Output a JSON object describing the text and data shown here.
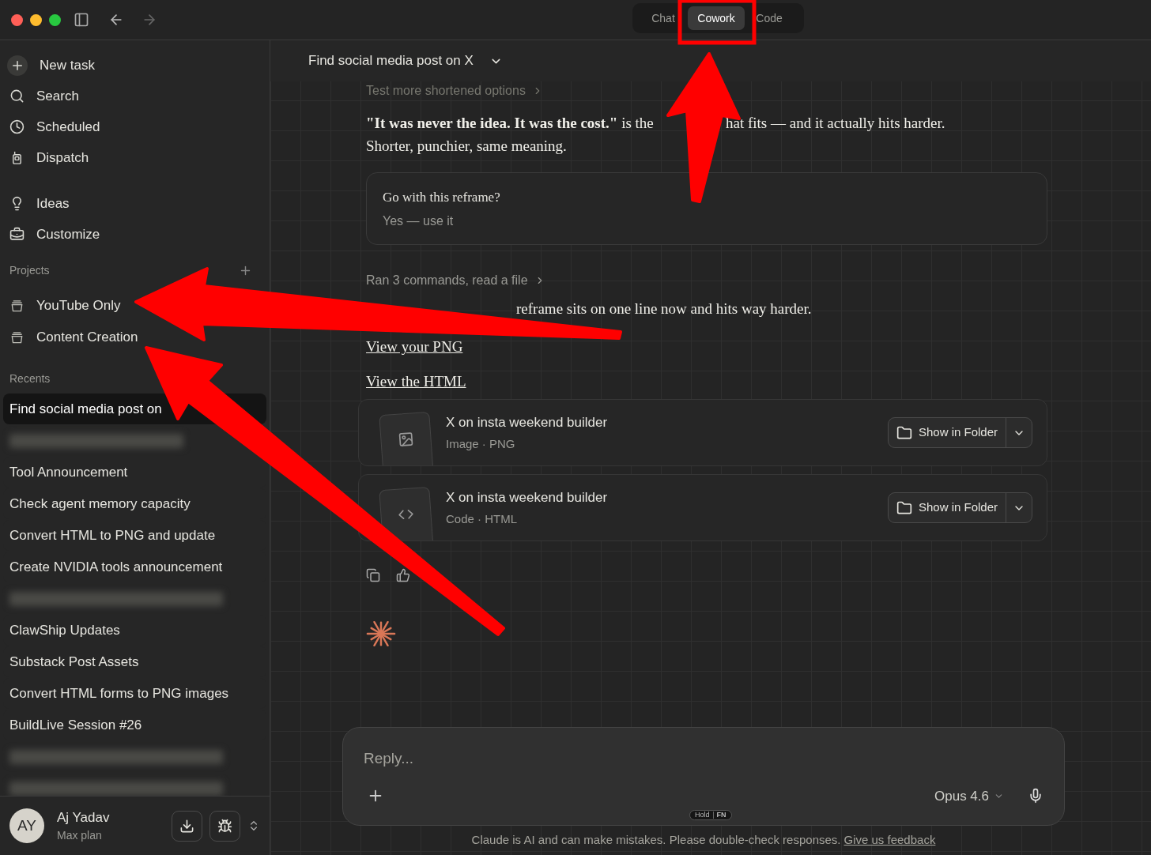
{
  "titlebar": {
    "tabs": [
      {
        "label": "Chat",
        "selected": false
      },
      {
        "label": "Cowork",
        "selected": true
      },
      {
        "label": "Code",
        "selected": false
      }
    ]
  },
  "sidebar": {
    "nav": [
      {
        "label": "New task",
        "kind": "new"
      },
      {
        "label": "Search",
        "kind": "search"
      },
      {
        "label": "Scheduled",
        "kind": "clock"
      },
      {
        "label": "Dispatch",
        "kind": "dispatch"
      }
    ],
    "nav_2": [
      {
        "label": "Ideas",
        "kind": "bulb"
      },
      {
        "label": "Customize",
        "kind": "toolbox"
      }
    ],
    "projects": {
      "title": "Projects",
      "items": [
        "YouTube Only",
        "Content Creation"
      ]
    },
    "recents": {
      "title": "Recents",
      "items": [
        {
          "kind": "chat",
          "label": "Find social media post on",
          "selected": true
        },
        {
          "kind": "blurred"
        },
        {
          "kind": "chat",
          "label": "Tool Announcement",
          "selected": false
        },
        {
          "kind": "chat",
          "label": "Check agent memory capacity",
          "selected": false
        },
        {
          "kind": "chat",
          "label": "Convert HTML to PNG and update",
          "selected": false
        },
        {
          "kind": "chat",
          "label": "Create NVIDIA tools announcement",
          "selected": false
        },
        {
          "kind": "blurred"
        },
        {
          "kind": "chat",
          "label": "ClawShip Updates",
          "selected": false
        },
        {
          "kind": "chat",
          "label": "Substack Post Assets",
          "selected": false
        },
        {
          "kind": "chat",
          "label": "Convert HTML forms to PNG images",
          "selected": false
        },
        {
          "kind": "chat",
          "label": "BuildLive Session #26",
          "selected": false
        },
        {
          "kind": "blurred"
        },
        {
          "kind": "blurred"
        }
      ]
    },
    "user": {
      "initials": "AY",
      "name": "Aj Yadav",
      "plan": "Max plan"
    }
  },
  "chat": {
    "title": "Find social media post on X",
    "steps_link_1": "Test more shortened options",
    "paragraph_1_part_a": "**\"It was never the idea. It was the cost.\"** is the",
    "paragraph_1_part_b": "hat fits — and it actually hits harder.",
    "paragraph_1_line_2": "Shorter, punchier, same meaning.",
    "question": {
      "prompt": "Go with this reframe?",
      "answer": "Yes — use it"
    },
    "steps_link_2": "Ran 3 commands, read a file",
    "paragraph_2": "reframe sits on one line now and hits way harder.",
    "links": [
      "View your PNG",
      "View the HTML"
    ],
    "files": [
      {
        "name": "X on insta weekend builder",
        "meta": "Image · PNG",
        "kind": "image",
        "button": "Show in Folder"
      },
      {
        "name": "X on insta weekend builder",
        "meta": "Code · HTML",
        "kind": "code",
        "button": "Show in Folder"
      }
    ]
  },
  "composer": {
    "placeholder": "Reply...",
    "model": "Opus 4.6",
    "hint_keys": [
      "Hold",
      "FN"
    ]
  },
  "disclaimer": {
    "text": "Claude is AI and can make mistakes. Please double-check responses.",
    "link": "Give us feedback"
  }
}
